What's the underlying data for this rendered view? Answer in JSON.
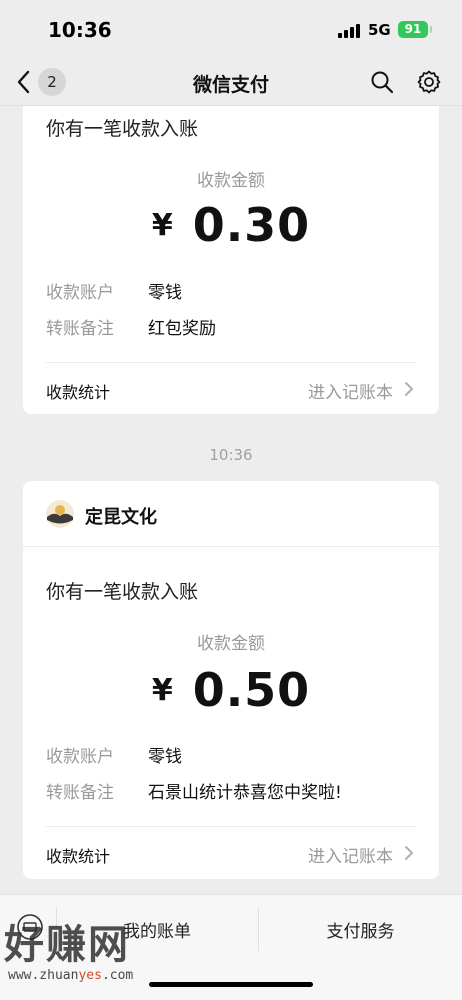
{
  "status_bar": {
    "time": "10:36",
    "network": "5G",
    "battery": "91"
  },
  "nav": {
    "back_badge": "2",
    "title": "微信支付",
    "icons": [
      "chevron-left-icon",
      "search-icon",
      "gear-icon"
    ]
  },
  "messages": [
    {
      "headline": "你有一笔收款入账",
      "amount_label": "收款金额",
      "currency": "¥",
      "amount": "0.30",
      "account_key": "收款账户",
      "account_value": "零钱",
      "note_key": "转账备注",
      "note_value": "红包奖励",
      "footer_left": "收款统计",
      "footer_right": "进入记账本"
    },
    {
      "timestamp": "10:36",
      "brand": "定昆文化",
      "headline": "你有一笔收款入账",
      "amount_label": "收款金额",
      "currency": "¥",
      "amount": "0.50",
      "account_key": "收款账户",
      "account_value": "零钱",
      "note_key": "转账备注",
      "note_value": "石景山统计恭喜您中奖啦!",
      "footer_left": "收款统计",
      "footer_right": "进入记账本"
    }
  ],
  "bottom_bar": {
    "left_label": "我的账单",
    "right_label": "支付服务"
  },
  "watermark": {
    "big": "好赚网",
    "small_pre": "www.zhuan",
    "small_accent": "yes",
    "small_post": ".com"
  },
  "colors": {
    "background": "#ededed",
    "card": "#ffffff",
    "battery": "#34c759",
    "muted_text": "#9a9a9a"
  }
}
